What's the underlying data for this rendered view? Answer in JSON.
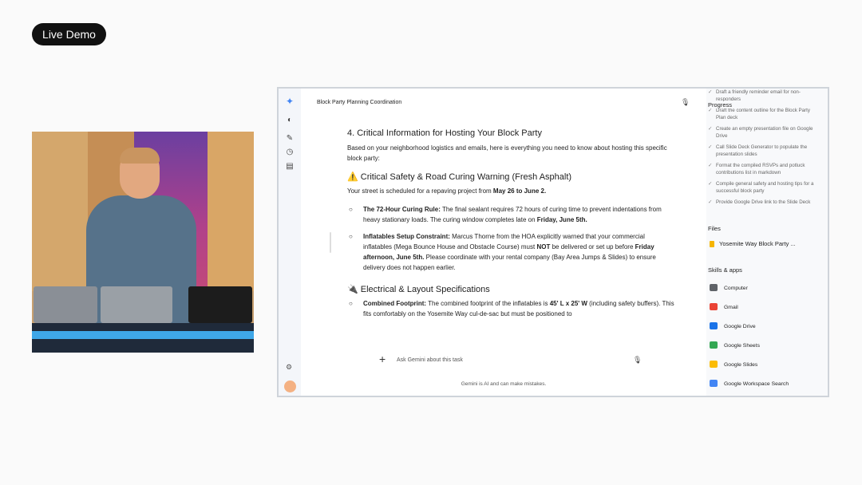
{
  "live_badge": "Live Demo",
  "app": {
    "title": "Block Party Planning Coordination",
    "content": {
      "section_heading": "4. Critical Information for Hosting Your Block Party",
      "intro": "Based on your neighborhood logistics and emails, here is everything you need to know about hosting this specific block party:",
      "warning_heading": "⚠️ Critical Safety & Road Curing Warning (Fresh Asphalt)",
      "warning_text_pre": "Your street is scheduled for a repaving project from ",
      "warning_text_dates": "May 26 to June 2.",
      "bullets": [
        {
          "label": "The 72-Hour Curing Rule:",
          "text": " The final sealant requires 72 hours of curing time to prevent indentations from heavy stationary loads. The curing window completes late on ",
          "bold_tail": "Friday, June 5th."
        },
        {
          "label": "Inflatables Setup Constraint:",
          "text": " Marcus Thorne from the HOA explicitly warned that your commercial inflatables (Mega Bounce House and Obstacle Course) must ",
          "bold_mid": "NOT",
          "text2": " be delivered or set up before ",
          "bold_mid2": "Friday afternoon, June 5th.",
          "text3": " Please coordinate with your rental company (Bay Area Jumps & Slides) to ensure delivery does not happen earlier."
        }
      ],
      "electrical_heading": "🔌 Electrical & Layout Specifications",
      "electrical_bullet": {
        "label": "Combined Footprint:",
        "text": " The combined footprint of the inflatables is ",
        "bold_mid": "45' L x 25' W",
        "text2": " (including safety buffers). This fits comfortably on the Yosemite Way cul-de-sac but must be positioned to"
      }
    },
    "input_placeholder": "Ask Gemini about this task",
    "disclaimer": "Gemini is AI and can make mistakes."
  },
  "sidebar": {
    "progress_title": "Progress",
    "progress_items": [
      "Draft a friendly reminder email for non-responders",
      "Draft the content outline for the Block Party Plan deck",
      "Create an empty presentation file on Google Drive",
      "Call Slide Deck Generator to populate the presentation slides",
      "Format the compiled RSVPs and potluck contributions list in markdown",
      "Compile general safety and hosting tips for a successful block party",
      "Provide Google Drive link to the Slide Deck"
    ],
    "files_title": "Files",
    "file_name": "Yosemite Way Block Party ...",
    "skills_title": "Skills & apps",
    "skills": [
      {
        "label": "Computer",
        "color": "#5f6368"
      },
      {
        "label": "Gmail",
        "color": "#ea4335"
      },
      {
        "label": "Google Drive",
        "color": "#1a73e8"
      },
      {
        "label": "Google Sheets",
        "color": "#34a853"
      },
      {
        "label": "Google Slides",
        "color": "#fbbc04"
      },
      {
        "label": "Google Workspace Search",
        "color": "#4285f4"
      }
    ]
  }
}
